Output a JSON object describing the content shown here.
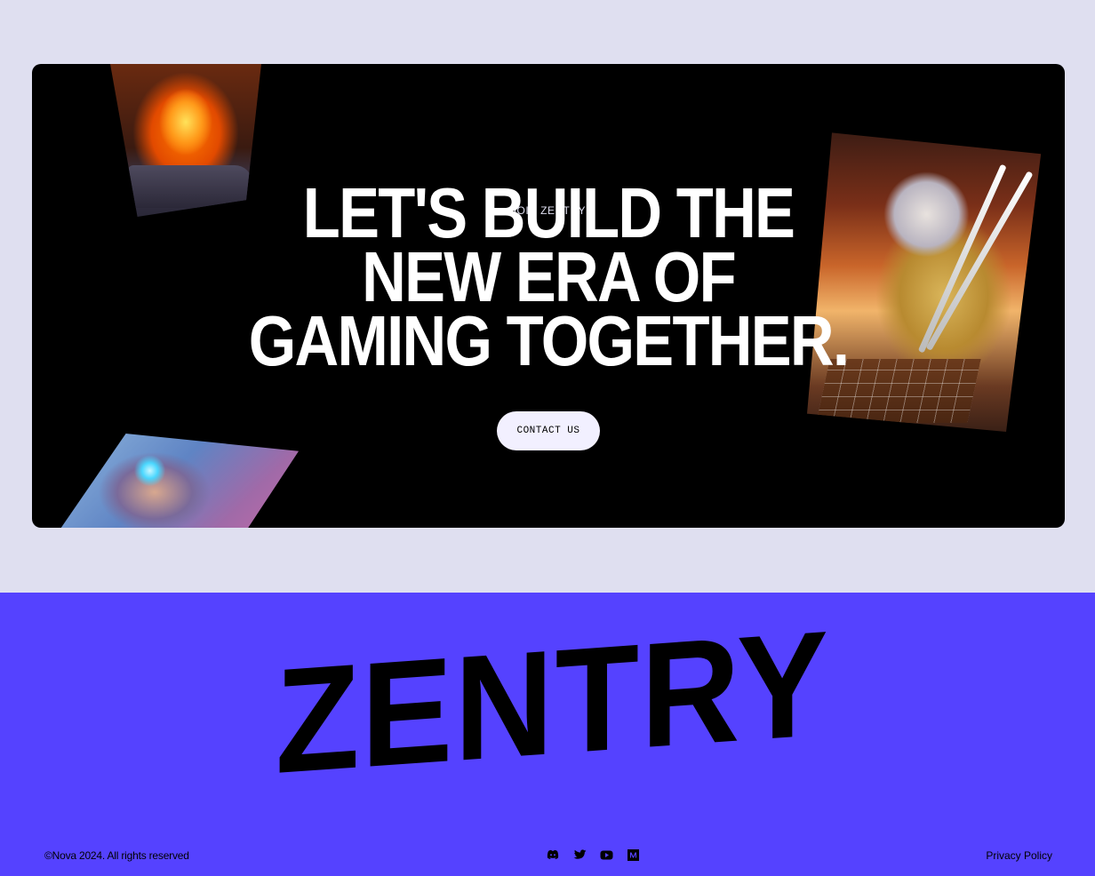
{
  "contact": {
    "eyebrow": "JOIN ZENTRY",
    "headline": [
      "LET'S BUILD THE",
      "NEW ERA OF",
      "GAMING TOGETHER."
    ],
    "button_label": "CONTACT US"
  },
  "brand": {
    "wordmark": "ZENTRY"
  },
  "footer": {
    "copyright": "©Nova 2024. All rights reserved",
    "privacy": "Privacy Policy",
    "socials": [
      "discord-icon",
      "twitter-icon",
      "youtube-icon",
      "medium-icon"
    ]
  },
  "colors": {
    "page_bg": "#dfdff0",
    "card_bg": "#000000",
    "brand_band": "#5542ff",
    "button_bg": "#f2f0ff"
  }
}
